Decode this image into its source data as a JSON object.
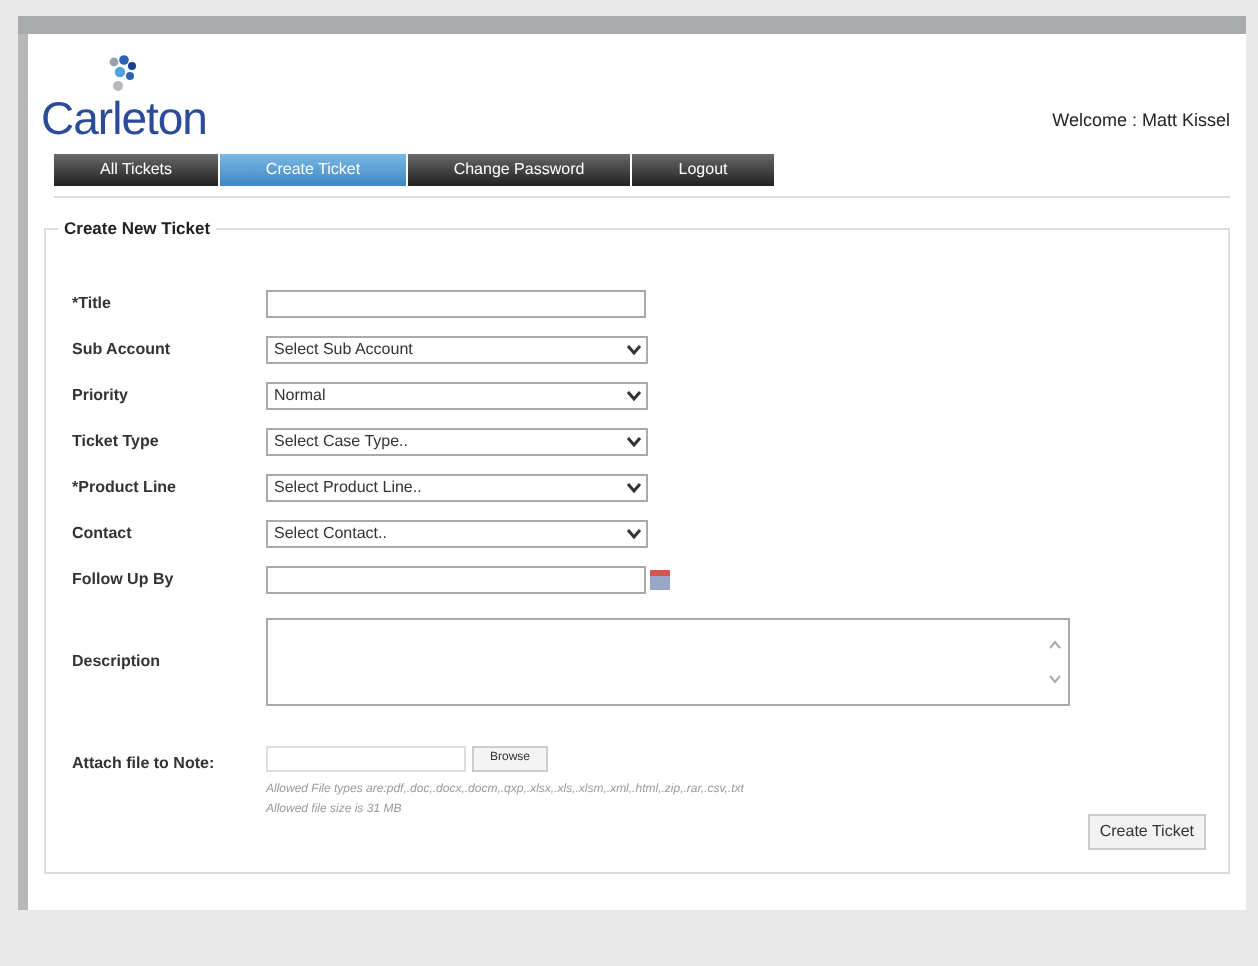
{
  "logo": {
    "text": "Carleton"
  },
  "welcome": "Welcome : Matt Kissel",
  "tabs": [
    {
      "label": "All Tickets",
      "selected": false
    },
    {
      "label": "Create Ticket",
      "selected": true
    },
    {
      "label": "Change Password",
      "selected": false
    },
    {
      "label": "Logout",
      "selected": false
    }
  ],
  "form": {
    "legend": "Create New Ticket",
    "fields": [
      {
        "kind": "text",
        "label": "*Title"
      },
      {
        "kind": "select",
        "label": "Sub Account",
        "value": "Select Sub Account"
      },
      {
        "kind": "select",
        "label": "Priority",
        "value": "Normal"
      },
      {
        "kind": "select",
        "label": "Ticket Type",
        "value": "Select Case Type.."
      },
      {
        "kind": "select",
        "label": "*Product Line",
        "value": "Select Product Line.."
      },
      {
        "kind": "select",
        "label": "Contact",
        "value": "Select Contact.."
      },
      {
        "kind": "date",
        "label": "Follow Up By"
      },
      {
        "kind": "textarea",
        "label": "Description"
      },
      {
        "kind": "file",
        "label": "Attach file to Note:",
        "button": "Browse",
        "hints": [
          "Allowed File types are:pdf,.doc,.docx,.docm,.qxp,.xlsx,.xls,.xlsm,.xml,.html,.zip,.rar,.csv,.txt",
          "Allowed file size is 31 MB"
        ]
      }
    ],
    "submit": "Create Ticket"
  }
}
